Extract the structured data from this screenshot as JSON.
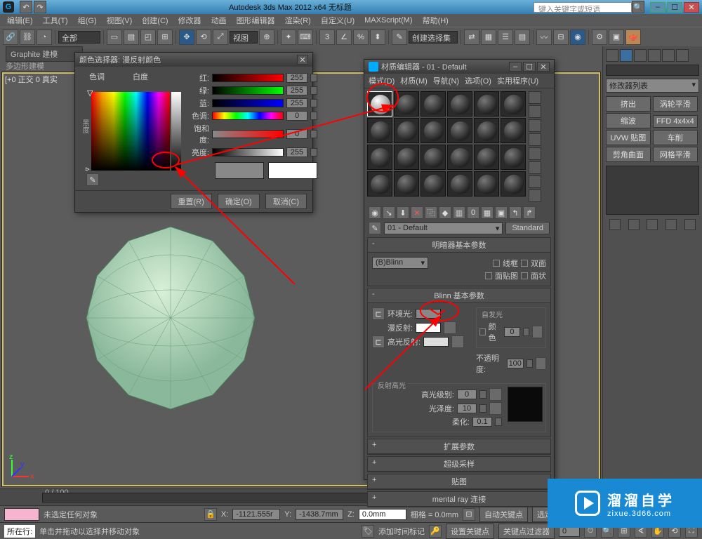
{
  "app": {
    "title": "Autodesk 3ds Max  2012  x64    无标题",
    "search_placeholder": "键入关键字或短语"
  },
  "menu": [
    "编辑(E)",
    "工具(T)",
    "组(G)",
    "视图(V)",
    "创建(C)",
    "修改器",
    "动画",
    "图形编辑器",
    "渲染(R)",
    "自定义(U)",
    "MAXScript(M)",
    "帮助(H)"
  ],
  "toolbar": {
    "selset_label": "全部",
    "create_set": "创建选择集"
  },
  "graphite": {
    "title": "Graphite 建模",
    "polymod": "多边形建模",
    "vplabel": "[+0 正交 0 真实"
  },
  "rightpanel": {
    "list_label": "修改器列表",
    "mods": [
      "挤出",
      "涡轮平滑",
      "缩波",
      "FFD 4x4x4",
      "UVW 贴图",
      "车削",
      "剪角曲面",
      "网格平滑"
    ]
  },
  "color_picker": {
    "title": "颜色选择器: 漫反射颜色",
    "hue_label": "色调",
    "white_label": "白度",
    "black_label": "黑度",
    "rows": [
      {
        "label": "红:",
        "val": "255",
        "grad": "linear-gradient(to right,#000,#f00)"
      },
      {
        "label": "绿:",
        "val": "255",
        "grad": "linear-gradient(to right,#000,#0f0)"
      },
      {
        "label": "蓝:",
        "val": "255",
        "grad": "linear-gradient(to right,#000,#00f)"
      },
      {
        "label": "色调:",
        "val": "0",
        "grad": "linear-gradient(to right,red,yellow,lime,cyan,blue,magenta,red)"
      },
      {
        "label": "饱和度:",
        "val": "0",
        "grad": "linear-gradient(to right,#888,#f00)"
      },
      {
        "label": "亮度:",
        "val": "255",
        "grad": "linear-gradient(to right,#000,#fff)"
      }
    ],
    "reset": "重置(R)",
    "ok": "确定(O)",
    "cancel": "取消(C)"
  },
  "material": {
    "title": "材质编辑器 - 01 - Default",
    "menu": [
      "模式(D)",
      "材质(M)",
      "导航(N)",
      "选项(O)",
      "实用程序(U)"
    ],
    "name": "01 - Default",
    "type_btn": "Standard",
    "rollouts": {
      "shader_head": "明暗器基本参数",
      "shader": "(B)Blinn",
      "wire": "线框",
      "two_sided": "双面",
      "face_map": "面贴图",
      "faceted": "面状",
      "blinn_head": "Blinn 基本参数",
      "self_illum": "自发光",
      "ambient": "环境光:",
      "diffuse": "漫反射:",
      "specular": "高光反射:",
      "color_lbl": "颜色",
      "color_val": "0",
      "opacity_lbl": "不透明度:",
      "opacity_val": "100",
      "spec_group": "反射高光",
      "spec_level": "高光级别:",
      "spec_level_val": "0",
      "gloss": "光泽度:",
      "gloss_val": "10",
      "soften": "柔化:",
      "soften_val": "0.1",
      "ext": "扩展参数",
      "ss": "超级采样",
      "maps": "贴图",
      "mray": "mental ray 连接"
    }
  },
  "timeline": {
    "range": "0 / 100"
  },
  "status": {
    "none_selected": "未选定任何对象",
    "hint": "单击并拖动以选择并移动对象",
    "x": "-1121.555r",
    "y": "-1438.7mm",
    "z": "0.0mm",
    "grid": "栅格 = 0.0mm",
    "autokey": "自动关键点",
    "selkey": "选定对象",
    "setkey": "设置关键点",
    "keyfilter": "关键点过滤器",
    "addtime": "添加时间标记",
    "allrows": "所在行:"
  },
  "watermark": {
    "big": "溜溜自学",
    "small": "zixue.3d66.com"
  }
}
